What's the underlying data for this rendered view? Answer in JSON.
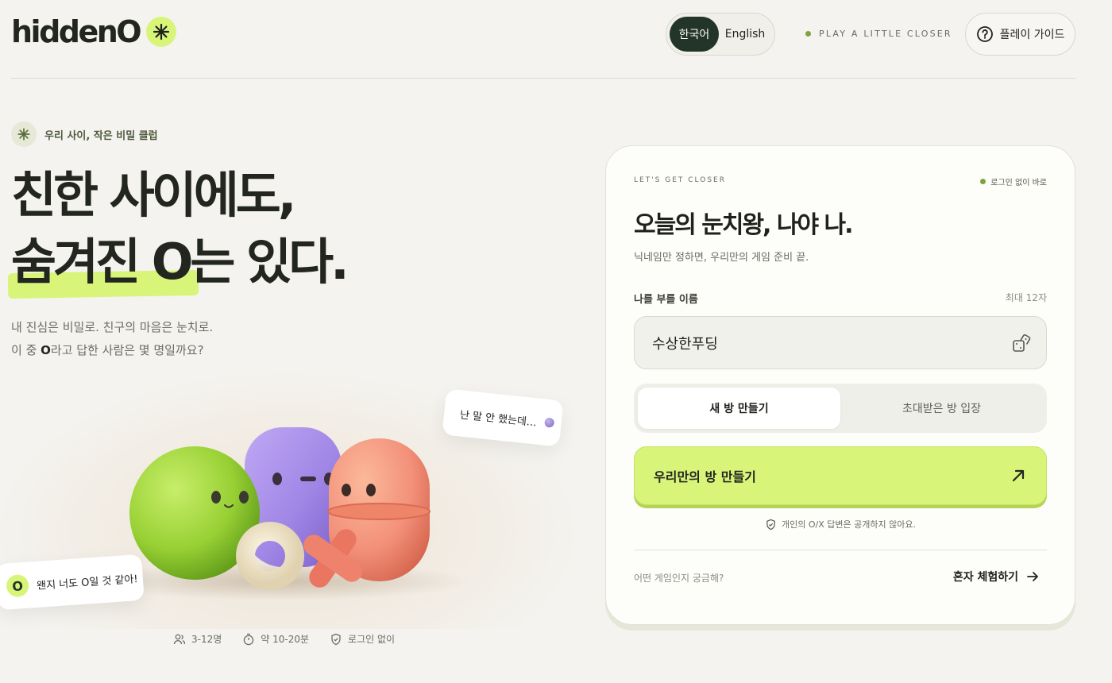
{
  "header": {
    "logo_text": "hiddenO",
    "lang_active": "한국어",
    "lang_inactive": "English",
    "tagline": "PLAY A LITTLE CLOSER",
    "guide_label": "플레이 가이드"
  },
  "hero": {
    "club_label": "우리 사이, 작은 비밀 클럽",
    "title_line1": "친한 사이에도,",
    "title_line2": "숨겨진 O는 있다.",
    "sub_line1": "내 진심은 비밀로. 친구의 마음은 눈치로.",
    "sub_line2_pre": "이 중 ",
    "sub_line2_bold": "O",
    "sub_line2_post": "라고 답한 사람은 몇 명일까요?"
  },
  "bubbles": {
    "top": "난 말 안 했는데…",
    "bottom_badge": "O",
    "bottom": "왠지 너도 O일 것 같아!"
  },
  "meta": {
    "players": "3-12명",
    "duration": "약 10-20분",
    "login": "로그인 없이"
  },
  "card": {
    "eyebrow": "LET'S GET CLOSER",
    "quick": "로그인 없이 바로",
    "title": "오늘의 눈치왕, 나야 나.",
    "subtitle": "닉네임만 정하면, 우리만의 게임 준비 끝.",
    "name_label": "나를 부를 이름",
    "name_max": "최대 12자",
    "name_value": "수상한푸딩",
    "tab_new": "새 방 만들기",
    "tab_join": "초대받은 방 입장",
    "cta_label": "우리만의 방 만들기",
    "privacy": "개인의 O/X 답변은 공개하지 않아요.",
    "curious": "어떤 게임인지 궁금해?",
    "solo_label": "혼자 체험하기"
  },
  "colors": {
    "accent": "#d8f57a",
    "dark": "#233528",
    "background": "#f4f3ef"
  },
  "icons": {
    "logo_badge": "asterisk-icon",
    "guide": "question-circle-icon",
    "club": "asterisk-icon",
    "dice": "dice-icon",
    "cta": "arrow-up-right-icon",
    "privacy": "shield-check-icon",
    "solo": "arrow-right-icon",
    "players": "users-icon",
    "duration": "timer-icon",
    "login": "shield-check-icon"
  }
}
